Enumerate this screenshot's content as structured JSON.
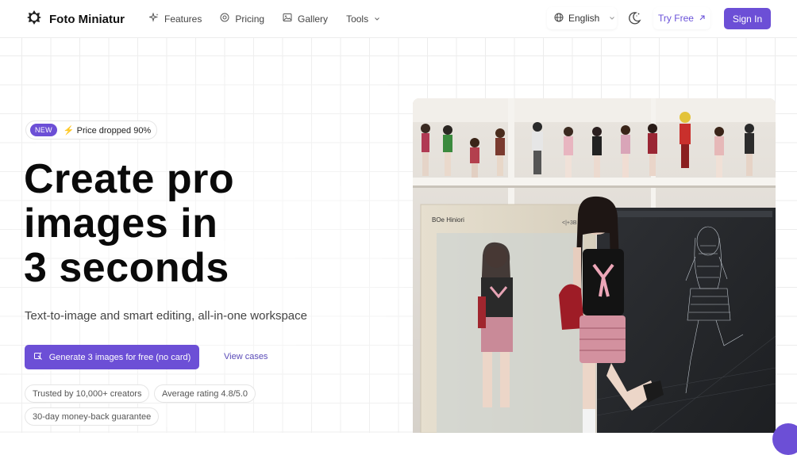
{
  "header": {
    "brand": "Foto Miniatur",
    "nav": [
      {
        "label": "Features",
        "icon": "sparkle-icon"
      },
      {
        "label": "Pricing",
        "icon": "coin-icon"
      },
      {
        "label": "Gallery",
        "icon": "image-icon"
      },
      {
        "label": "Tools",
        "icon": "chevron-down-icon"
      }
    ],
    "language": "English",
    "try_free": "Try Free",
    "sign_in": "Sign In"
  },
  "hero": {
    "badge_new": "NEW",
    "badge_text": "⚡ Price dropped 90%",
    "headline": [
      "Create pro",
      "images in",
      "3 seconds"
    ],
    "subhead": "Text-to-image and smart editing, all-in-one workspace",
    "cta": "Generate 3 images for free (no card)",
    "view_cases": "View cases",
    "trust": [
      "Trusted by 10,000+ creators",
      "Average rating 4.8/5.0",
      "30-day money-back guarantee"
    ]
  },
  "image": {
    "box_label": "BOe Hiniori",
    "box_side_label": "<|+3B"
  },
  "colors": {
    "accent": "#6c4fd6",
    "grid": "#ececec"
  }
}
